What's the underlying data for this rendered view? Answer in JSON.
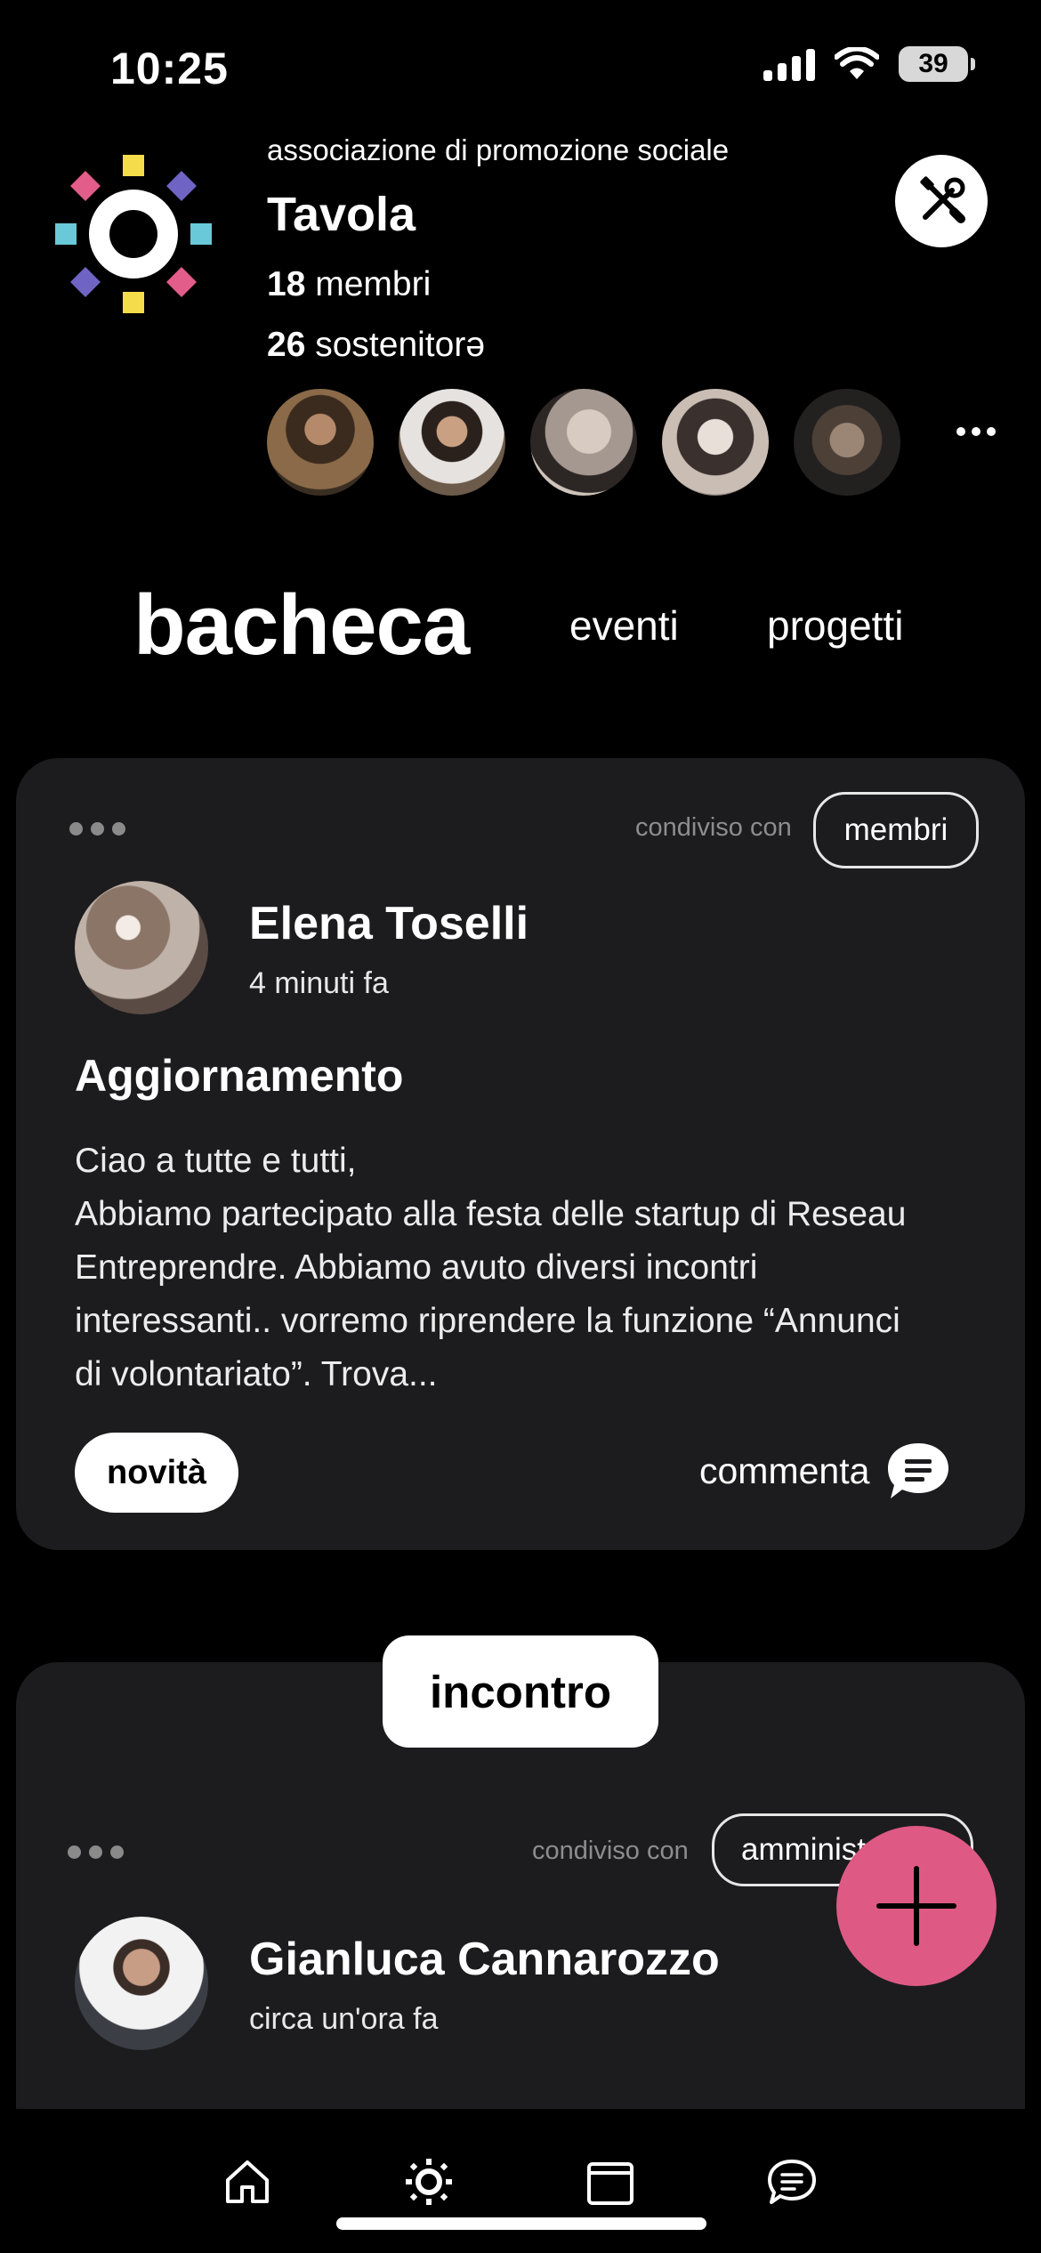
{
  "status_bar": {
    "time": "10:25",
    "battery": "39"
  },
  "header": {
    "org_type": "associazione di promozione sociale",
    "org_name": "Tavola",
    "members_count": "18",
    "members_label": "membri",
    "supporters_count": "26",
    "supporters_label": "sostenitorə"
  },
  "tabs": {
    "active": "bacheca",
    "events": "eventi",
    "projects": "progetti"
  },
  "posts": [
    {
      "shared_label": "condiviso con",
      "audience": "membri",
      "author": "Elena Toselli",
      "time": "4 minuti fa",
      "title": "Aggiornamento",
      "body_lines": [
        "Ciao a tutte e tutti,",
        "Abbiamo partecipato alla festa delle startup di Reseau",
        "Entreprendre. Abbiamo avuto diversi incontri",
        "interessanti.. vorremo riprendere la funzione “Annunci",
        "di volontariato”. Trova..."
      ],
      "tag": "novità",
      "comment_label": "commenta"
    },
    {
      "badge": "incontro",
      "shared_label": "condiviso con",
      "audience": "amminist",
      "author": "Gianluca Cannarozzo",
      "time": "circa un'ora fa"
    }
  ],
  "colors": {
    "background": "#000000",
    "card": "#1c1c1e",
    "fab": "#de5a84"
  },
  "icons": {
    "logo": "sun-logo-icon",
    "tools": "tools-icon",
    "fab": "plus-icon",
    "nav": [
      "home-icon",
      "sun-icon",
      "calendar-icon",
      "chat-icon"
    ]
  }
}
